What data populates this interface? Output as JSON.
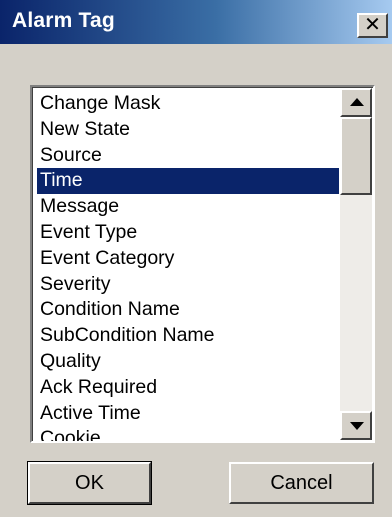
{
  "window": {
    "title": "Alarm Tag",
    "close_glyph": "✕",
    "close_icon": "close-icon"
  },
  "list": {
    "items": [
      "Change Mask",
      "New State",
      "Source",
      "Time",
      "Message",
      "Event Type",
      "Event Category",
      "Severity",
      "Condition Name",
      "SubCondition Name",
      "Quality",
      "Ack Required",
      "Active Time",
      "Cookie"
    ],
    "selected_index": 3,
    "selected_value": "Time"
  },
  "scrollbar": {
    "up_icon": "arrow-up-icon",
    "down_icon": "arrow-down-icon"
  },
  "buttons": {
    "ok_label": "OK",
    "cancel_label": "Cancel"
  },
  "colors": {
    "titlebar_start": "#0a246a",
    "titlebar_end": "#a6caf0",
    "selection": "#0a246a",
    "face": "#d4d0c8"
  }
}
